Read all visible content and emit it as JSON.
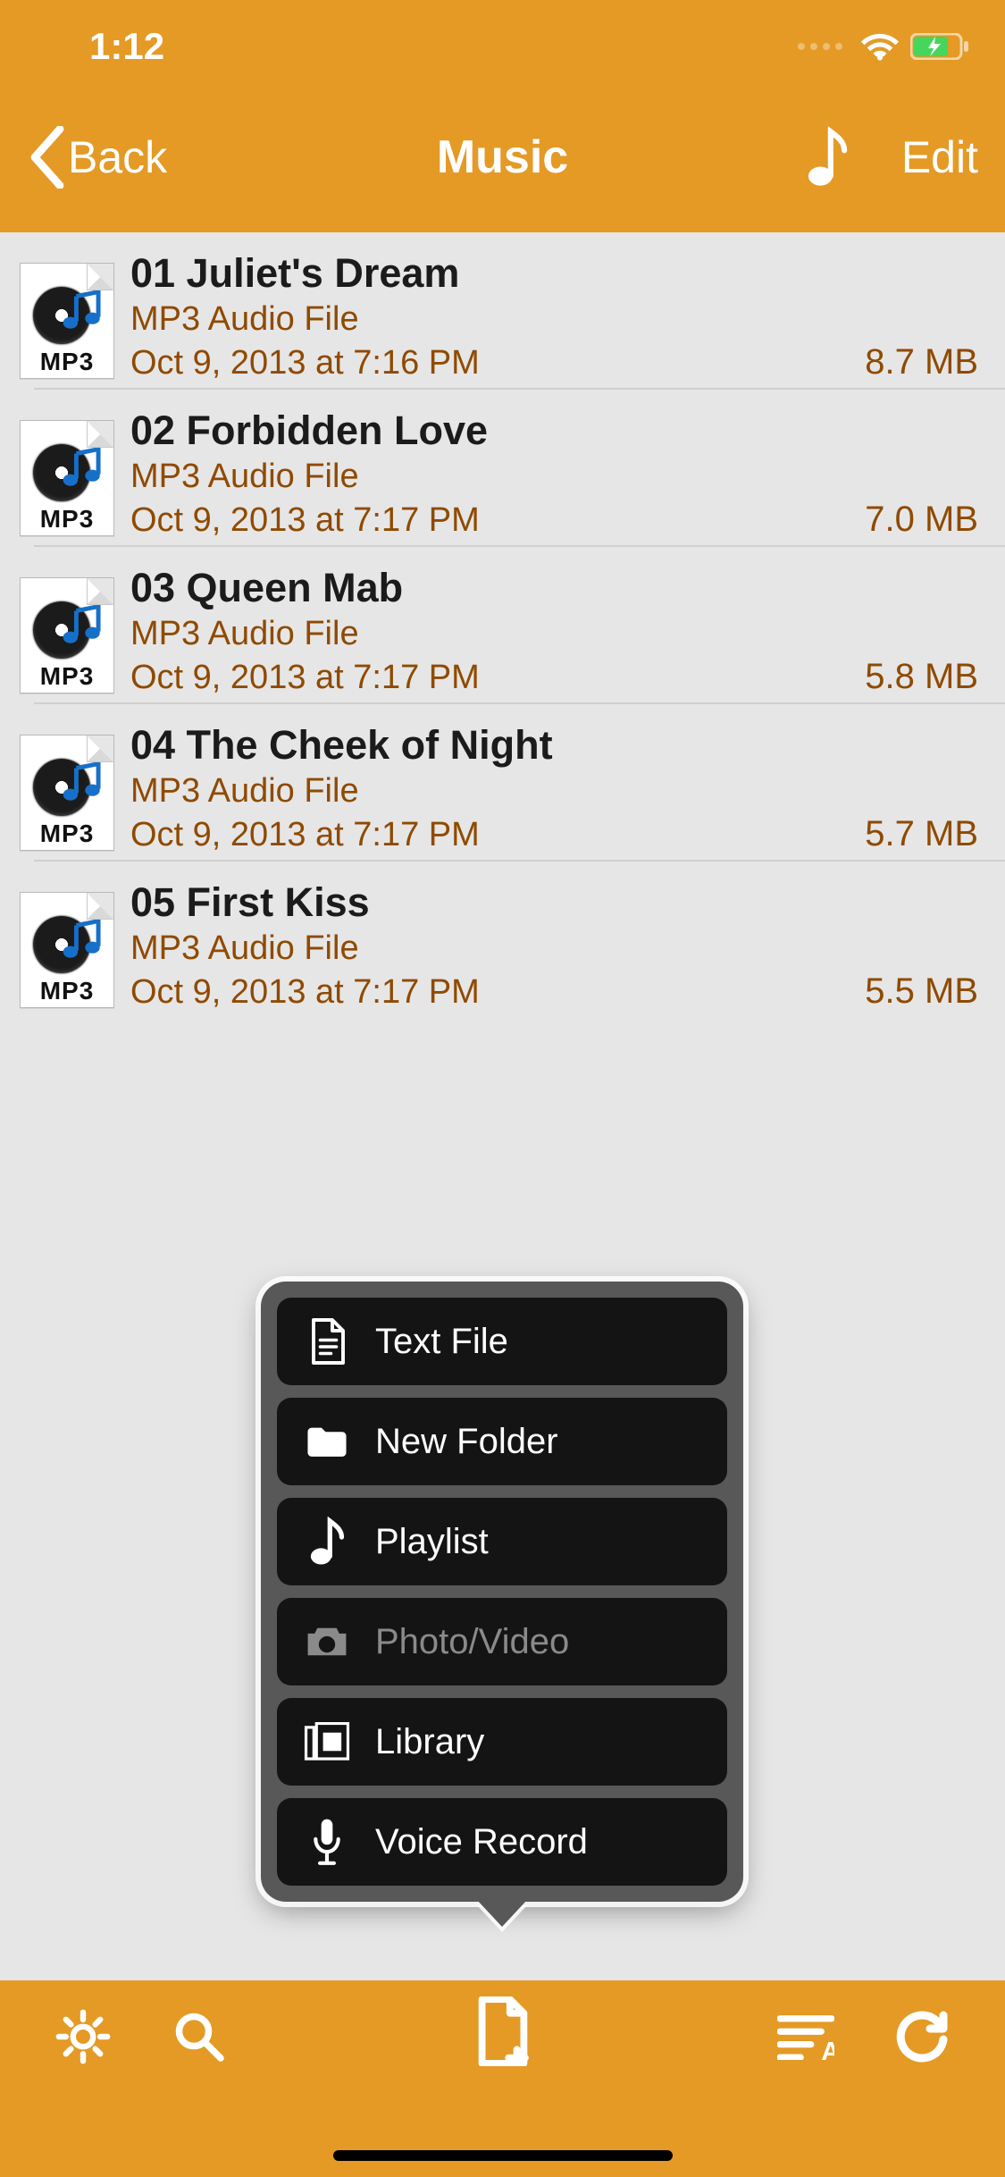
{
  "status": {
    "time": "1:12"
  },
  "nav": {
    "back_label": "Back",
    "title": "Music",
    "edit_label": "Edit"
  },
  "file_ext_label": "MP3",
  "files": [
    {
      "title": "01 Juliet's Dream",
      "kind": "MP3 Audio File",
      "date": "Oct 9, 2013 at 7:16 PM",
      "size": "8.7 MB"
    },
    {
      "title": "02 Forbidden Love",
      "kind": "MP3 Audio File",
      "date": "Oct 9, 2013 at 7:17 PM",
      "size": "7.0 MB"
    },
    {
      "title": "03 Queen Mab",
      "kind": "MP3 Audio File",
      "date": "Oct 9, 2013 at 7:17 PM",
      "size": "5.8 MB"
    },
    {
      "title": "04 The Cheek of Night",
      "kind": "MP3 Audio File",
      "date": "Oct 9, 2013 at 7:17 PM",
      "size": "5.7 MB"
    },
    {
      "title": "05 First Kiss",
      "kind": "MP3 Audio File",
      "date": "Oct 9, 2013 at 7:17 PM",
      "size": "5.5 MB"
    }
  ],
  "popover": {
    "items": [
      {
        "label": "Text File",
        "icon": "text-file-icon",
        "disabled": false
      },
      {
        "label": "New Folder",
        "icon": "folder-icon",
        "disabled": false
      },
      {
        "label": "Playlist",
        "icon": "music-note-icon",
        "disabled": false
      },
      {
        "label": "Photo/Video",
        "icon": "camera-icon",
        "disabled": true
      },
      {
        "label": "Library",
        "icon": "library-icon",
        "disabled": false
      },
      {
        "label": "Voice Record",
        "icon": "microphone-icon",
        "disabled": false
      }
    ]
  },
  "colors": {
    "accent": "#e49a25",
    "text_secondary": "#8f4a00"
  }
}
